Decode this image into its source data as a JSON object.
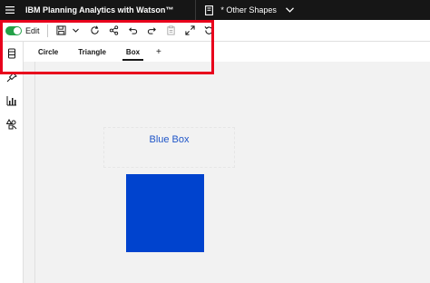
{
  "header": {
    "app_title": "IBM Planning Analytics with Watson™",
    "book_name": "* Other Shapes"
  },
  "toolbar": {
    "edit_label": "Edit",
    "edit_enabled": true,
    "toggle_color": "#24a148"
  },
  "tabs": [
    {
      "label": "Circle",
      "active": false
    },
    {
      "label": "Triangle",
      "active": false
    },
    {
      "label": "Box",
      "active": true
    }
  ],
  "add_tab_label": "+",
  "canvas": {
    "box_label": "Blue Box",
    "box_color": "#0043ce",
    "label_color": "#1f55c8"
  },
  "annotation": {
    "highlight_color": "#e8001c"
  },
  "icons": {
    "menu": "hamburger-menu-icon",
    "book": "book-icon",
    "chevron": "chevron-down-icon",
    "save": "save-icon",
    "refresh": "refresh-icon",
    "share": "share-icon",
    "undo": "undo-icon",
    "redo": "redo-icon",
    "clipboard": "clipboard-icon",
    "fullscreen": "expand-icon",
    "reset": "reset-icon"
  }
}
